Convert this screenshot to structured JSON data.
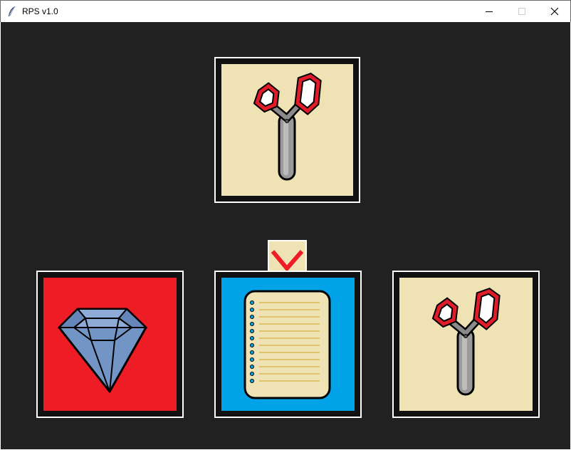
{
  "window": {
    "title": "RPS v1.0",
    "controls": [
      "minimize",
      "maximize",
      "close"
    ]
  },
  "computer_choice": {
    "icon": "scissors-icon",
    "background": "#efe3b5"
  },
  "result_indicator": {
    "icon": "checkmark-icon",
    "color": "#ee1c25"
  },
  "player_options": [
    {
      "name": "rock",
      "icon": "diamond-icon",
      "background": "#ee1c25"
    },
    {
      "name": "paper",
      "icon": "paper-icon",
      "background": "#00a2e8"
    },
    {
      "name": "scissors",
      "icon": "scissors-icon",
      "background": "#efe3b5"
    }
  ],
  "colors": {
    "client_background": "#212121",
    "tile_border": "#ffffff"
  }
}
